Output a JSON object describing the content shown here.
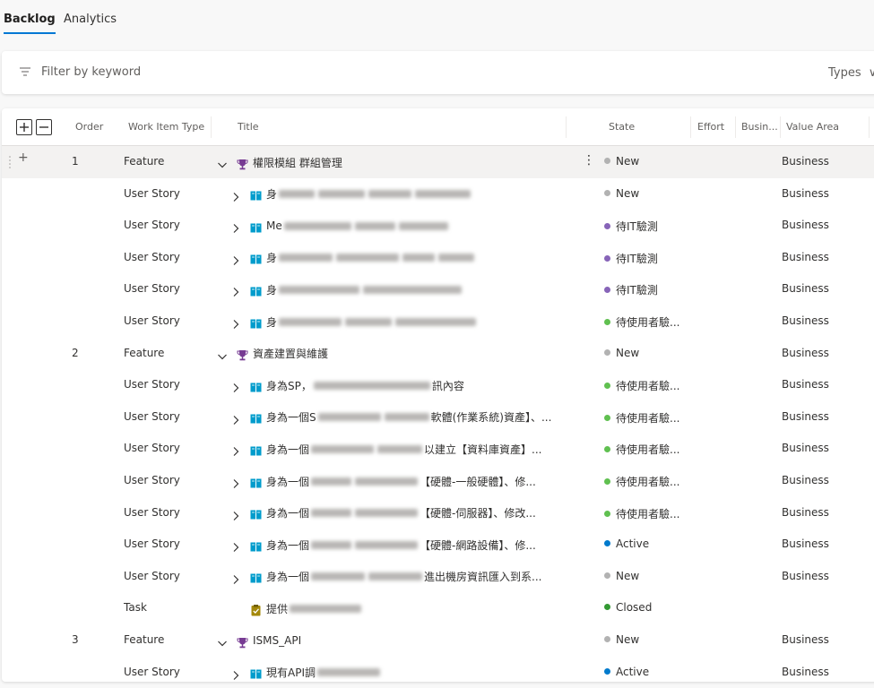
{
  "tabs": [
    {
      "label": "Backlog",
      "active": true
    },
    {
      "label": "Analytics",
      "active": false
    }
  ],
  "filter": {
    "placeholder": "Filter by keyword",
    "types_label": "Types"
  },
  "columns": {
    "order": "Order",
    "work_item_type": "Work Item Type",
    "title": "Title",
    "state": "State",
    "effort": "Effort",
    "business": "Busin...",
    "value_area": "Value Area"
  },
  "colors": {
    "accent": "#0078d4",
    "state_new": "#b2b2b2",
    "state_it_test": "#8764b8",
    "state_user_test": "#60c050",
    "state_active": "#007acc",
    "state_closed": "#339933",
    "feature_icon": "#773b93",
    "story_icon": "#009ccc",
    "task_icon": "#a4880a"
  },
  "rows": [
    {
      "order": "1",
      "type": "Feature",
      "icon": "trophy-icon",
      "expand": "down",
      "indent": 0,
      "title": "權限模組 群組管理",
      "state": "New",
      "state_color": "#b2b2b2",
      "value": "Business",
      "selected": true
    },
    {
      "order": "",
      "type": "User Story",
      "icon": "book-icon",
      "expand": "right",
      "indent": 1,
      "title": "身",
      "blurs": [
        40,
        52,
        48,
        62
      ],
      "state": "New",
      "state_color": "#b2b2b2",
      "value": "Business"
    },
    {
      "order": "",
      "type": "User Story",
      "icon": "book-icon",
      "expand": "right",
      "indent": 1,
      "title": "Me",
      "blurs": [
        75,
        45,
        55
      ],
      "state": "待IT驗測",
      "state_color": "#8764b8",
      "value": "Business"
    },
    {
      "order": "",
      "type": "User Story",
      "icon": "book-icon",
      "expand": "right",
      "indent": 1,
      "title": "身",
      "blurs": [
        60,
        70,
        36,
        40
      ],
      "state": "待IT驗測",
      "state_color": "#8764b8",
      "value": "Business"
    },
    {
      "order": "",
      "type": "User Story",
      "icon": "book-icon",
      "expand": "right",
      "indent": 1,
      "title": "身",
      "blurs": [
        90,
        110
      ],
      "state": "待IT驗測",
      "state_color": "#8764b8",
      "value": "Business"
    },
    {
      "order": "",
      "type": "User Story",
      "icon": "book-icon",
      "expand": "right",
      "indent": 1,
      "title": "身",
      "blurs": [
        70,
        52,
        90
      ],
      "state": "待使用者驗...",
      "state_color": "#60c050",
      "value": "Business"
    },
    {
      "order": "2",
      "type": "Feature",
      "icon": "trophy-icon",
      "expand": "down",
      "indent": 0,
      "title": "資產建置與維護",
      "state": "New",
      "state_color": "#b2b2b2",
      "value": "Business"
    },
    {
      "order": "",
      "type": "User Story",
      "icon": "book-icon",
      "expand": "right",
      "indent": 1,
      "title": "身為SP，",
      "blurs": [
        130
      ],
      "suffix": "訊內容",
      "state": "待使用者驗...",
      "state_color": "#60c050",
      "value": "Business"
    },
    {
      "order": "",
      "type": "User Story",
      "icon": "book-icon",
      "expand": "right",
      "indent": 1,
      "title": "身為一個S",
      "blurs": [
        70,
        50
      ],
      "suffix": "軟體(作業系統)資產】、...",
      "state": "待使用者驗...",
      "state_color": "#60c050",
      "value": "Business"
    },
    {
      "order": "",
      "type": "User Story",
      "icon": "book-icon",
      "expand": "right",
      "indent": 1,
      "title": "身為一個",
      "blurs": [
        70,
        50
      ],
      "suffix": "以建立【資料庫資產】...",
      "state": "待使用者驗...",
      "state_color": "#60c050",
      "value": "Business"
    },
    {
      "order": "",
      "type": "User Story",
      "icon": "book-icon",
      "expand": "right",
      "indent": 1,
      "title": "身為一個",
      "blurs": [
        45,
        70
      ],
      "suffix": "【硬體-一般硬體】、修...",
      "state": "待使用者驗...",
      "state_color": "#60c050",
      "value": "Business"
    },
    {
      "order": "",
      "type": "User Story",
      "icon": "book-icon",
      "expand": "right",
      "indent": 1,
      "title": "身為一個",
      "blurs": [
        45,
        70
      ],
      "suffix": "【硬體-伺服器】、修改...",
      "state": "待使用者驗...",
      "state_color": "#60c050",
      "value": "Business"
    },
    {
      "order": "",
      "type": "User Story",
      "icon": "book-icon",
      "expand": "right",
      "indent": 1,
      "title": "身為一個",
      "blurs": [
        45,
        70
      ],
      "suffix": "【硬體-網路設備】、修...",
      "state": "Active",
      "state_color": "#007acc",
      "value": "Business"
    },
    {
      "order": "",
      "type": "User Story",
      "icon": "book-icon",
      "expand": "right",
      "indent": 1,
      "title": "身為一個",
      "blurs": [
        60,
        60
      ],
      "suffix": "進出機房資訊匯入到系...",
      "state": "New",
      "state_color": "#b2b2b2",
      "value": "Business"
    },
    {
      "order": "",
      "type": "Task",
      "icon": "task-icon",
      "expand": "none",
      "indent": 1,
      "title": "提供",
      "blurs": [
        80
      ],
      "state": "Closed",
      "state_color": "#339933",
      "value": ""
    },
    {
      "order": "3",
      "type": "Feature",
      "icon": "trophy-icon",
      "expand": "down",
      "indent": 0,
      "title": "ISMS_API",
      "state": "New",
      "state_color": "#b2b2b2",
      "value": "Business"
    },
    {
      "order": "",
      "type": "User Story",
      "icon": "book-icon",
      "expand": "right",
      "indent": 1,
      "title": "現有API調",
      "blurs": [
        70
      ],
      "state": "Active",
      "state_color": "#007acc",
      "value": "Business"
    }
  ]
}
